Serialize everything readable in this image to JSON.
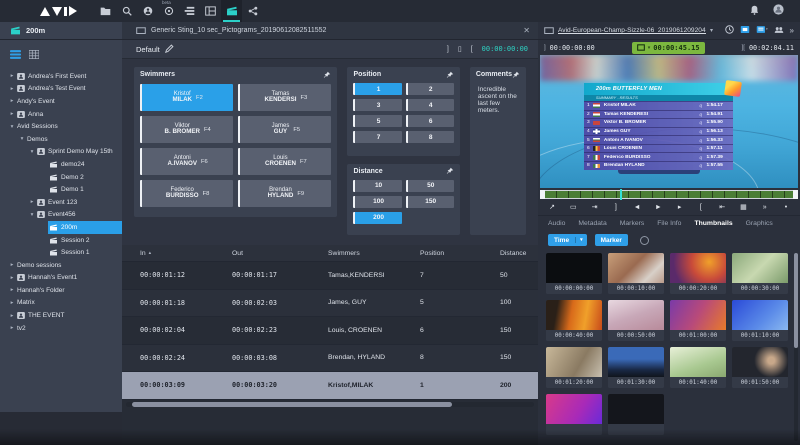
{
  "colors": {
    "accent_blue": "#2a9fe8",
    "teal": "#2bd0c8",
    "green_badge": "#7cb83f",
    "selected_row": "#9ba1b2"
  },
  "topbar": {
    "beta_label": "beta"
  },
  "tabs": {
    "left_tab": "200m",
    "main_tab": "Generic Sting_10 sec_Pictograms_20190612082511552",
    "close_glyph": "✕"
  },
  "sidebar": {
    "items": [
      {
        "arrow": "▸",
        "label": "Andrea's First Event"
      },
      {
        "arrow": "▸",
        "label": "Andrea's Test Event"
      },
      {
        "arrow": "▸",
        "label": "Andy's Event"
      },
      {
        "arrow": "▸",
        "label": "Anna"
      },
      {
        "arrow": "▾",
        "label": "Avid Sessions"
      },
      {
        "arrow": "▾",
        "label": "Demos"
      },
      {
        "arrow": "▾",
        "label": "Sprint Demo May 15th"
      },
      {
        "arrow": "",
        "label": "demo24"
      },
      {
        "arrow": "",
        "label": "Demo 2"
      },
      {
        "arrow": "",
        "label": "Demo 1"
      },
      {
        "arrow": "▸",
        "label": "Event 123"
      },
      {
        "arrow": "▾",
        "label": "Event456"
      },
      {
        "arrow": "",
        "label": "200m"
      },
      {
        "arrow": "",
        "label": "Session 2"
      },
      {
        "arrow": "",
        "label": "Session 1"
      },
      {
        "arrow": "▸",
        "label": "Demo sessions"
      },
      {
        "arrow": "▸",
        "label": "Hannah's Event1"
      },
      {
        "arrow": "▸",
        "label": "Hannah's Folder"
      },
      {
        "arrow": "▸",
        "label": "Matrix"
      },
      {
        "arrow": "▸",
        "label": "THE EVENT"
      },
      {
        "arrow": "▸",
        "label": "tv2"
      }
    ]
  },
  "form": {
    "preset": "Default",
    "header_icons": [
      "]",
      "▯",
      "["
    ],
    "timecode": "00:00:00:00",
    "swimmers": {
      "title": "Swimmers",
      "buttons": [
        {
          "first": "Kristof",
          "last": "MILAK",
          "key": "F2"
        },
        {
          "first": "Tamas",
          "last": "KENDERSI",
          "key": "F3"
        },
        {
          "first": "Viktor",
          "last": "B. BROMER",
          "key": "F4"
        },
        {
          "first": "James",
          "last": "GUY",
          "key": "F5"
        },
        {
          "first": "Antoni",
          "last": "A.IVANOV",
          "key": "F6"
        },
        {
          "first": "Louis",
          "last": "CROENEN",
          "key": "F7"
        },
        {
          "first": "Federico",
          "last": "BURDISSO",
          "key": "F8"
        },
        {
          "first": "Brendan",
          "last": "HYLAND",
          "key": "F9"
        }
      ]
    },
    "position": {
      "title": "Position",
      "values": [
        "1",
        "2",
        "3",
        "4",
        "5",
        "6",
        "7",
        "8"
      ],
      "selected": "1"
    },
    "distance": {
      "title": "Distance",
      "values": [
        "10",
        "50",
        "100",
        "150",
        "200"
      ],
      "selected": "200"
    },
    "comments": {
      "title": "Comments",
      "text": "Incredible ascent on the last few meters."
    }
  },
  "table": {
    "columns": [
      "In",
      "Out",
      "Swimmers",
      "Position",
      "Distance"
    ],
    "sort_glyph": "▴",
    "rows": [
      [
        "00:00:01:12",
        "00:00:01:17",
        "Tamas,KENDERSI",
        "7",
        "50"
      ],
      [
        "00:00:01:18",
        "00:00:02:03",
        "James, GUY",
        "5",
        "100"
      ],
      [
        "00:00:02:04",
        "00:00:02:23",
        "Louis, CROENEN",
        "6",
        "150"
      ],
      [
        "00:00:02:24",
        "00:00:03:08",
        "Brendan, HYLAND",
        "8",
        "150"
      ],
      [
        "00:00:03:09",
        "00:00:03:20",
        "Kristof,MILAK",
        "1",
        "200"
      ]
    ]
  },
  "player": {
    "title": "Avid-European-Champ-Sizzle-06_20190612092049914...",
    "caret": "▾",
    "tc_in": "00:00:00:00",
    "tc_pos": "00:00:45.15",
    "tc_out": "00:02:04.11",
    "in_glyph": "]",
    "out_glyph": "][",
    "more_glyph": "»",
    "transport_glyphs": [
      "↗",
      "▭",
      "⇥",
      "]",
      "◄",
      "►",
      "▸",
      "[",
      "⇤",
      "▦",
      "»",
      "•"
    ]
  },
  "overlay": {
    "title": "200m BUTTERFLY MEN",
    "subtitle": "SUMMARY - RESULTS",
    "rows": [
      {
        "rank": "1",
        "name": "Kristof MILAK",
        "q": "q",
        "time": "1:54.17"
      },
      {
        "rank": "2",
        "name": "Tamas KENDERESI",
        "q": "q",
        "time": "1:54.91"
      },
      {
        "rank": "3",
        "name": "Viktor B. BROMER",
        "q": "q",
        "time": "1:55.90"
      },
      {
        "rank": "4",
        "name": "James GUY",
        "q": "q",
        "time": "1:56.13"
      },
      {
        "rank": "5",
        "name": "Antoni A IVANOV",
        "q": "q",
        "time": "1:56.33"
      },
      {
        "rank": "6",
        "name": "Louis CROENEN",
        "q": "q",
        "time": "1:57.11"
      },
      {
        "rank": "7",
        "name": "Federico BURDISSO",
        "q": "q",
        "time": "1:57.39"
      },
      {
        "rank": "8",
        "name": "Brendan HYLAND",
        "q": "q",
        "time": "1:57.55"
      }
    ]
  },
  "panel_tabs": {
    "items": [
      "Audio",
      "Metadata",
      "Markers",
      "File Info",
      "Thumbnails",
      "Graphics"
    ],
    "selected": "Thumbnails"
  },
  "filters": {
    "time_label": "Time",
    "time_caret": "▾",
    "marker_label": "Marker"
  },
  "thumbs": {
    "items": [
      {
        "time": "00:00:00:00"
      },
      {
        "time": "00:00:10:00"
      },
      {
        "time": "00:00:20:00"
      },
      {
        "time": "00:00:30:00"
      },
      {
        "time": "00:00:40:00"
      },
      {
        "time": "00:00:50:00"
      },
      {
        "time": "00:01:00:00"
      },
      {
        "time": "00:01:10:00"
      },
      {
        "time": "00:01:20:00"
      },
      {
        "time": "00:01:30:00"
      },
      {
        "time": "00:01:40:00"
      },
      {
        "time": "00:01:50:00"
      },
      {
        "time": ""
      },
      {
        "time": ""
      }
    ]
  }
}
